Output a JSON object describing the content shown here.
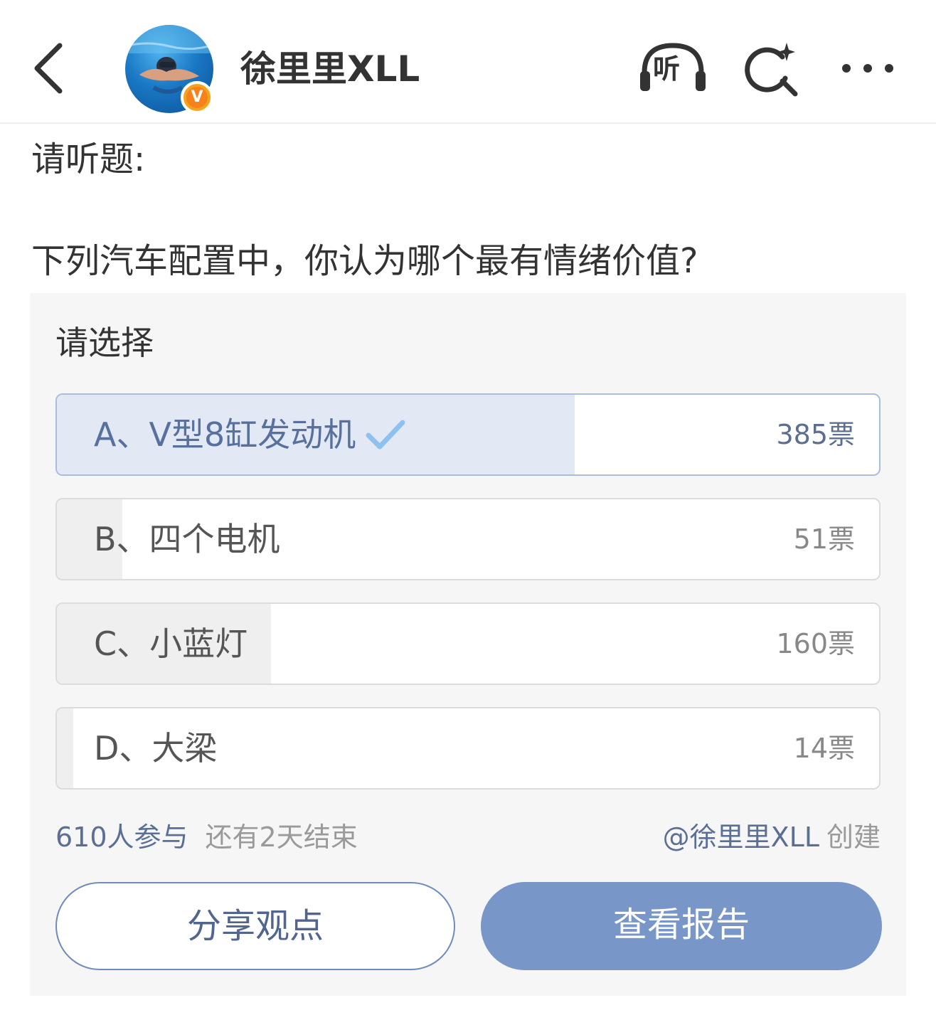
{
  "header": {
    "username": "徐里里XLL",
    "verified_badge": "V",
    "listen_label": "听",
    "icons": [
      "back-arrow-icon",
      "avatar",
      "listen-headphones-icon",
      "search-sparkle-icon",
      "more-icon"
    ]
  },
  "post": {
    "title": "请听题:",
    "question": "下列汽车配置中，你认为哪个最有情绪价值?"
  },
  "poll": {
    "prompt": "请选择",
    "options": [
      {
        "label": "A、V型8缸发动机",
        "votes": "385票",
        "selected": true,
        "share": 0.63
      },
      {
        "label": "B、四个电机",
        "votes": "51票",
        "selected": false,
        "share": 0.08
      },
      {
        "label": "C、小蓝灯",
        "votes": "160票",
        "selected": false,
        "share": 0.26
      },
      {
        "label": "D、大梁",
        "votes": "14票",
        "selected": false,
        "share": 0.02
      }
    ],
    "participants": "610人参与",
    "deadline": "还有2天结束",
    "creator": "@徐里里XLL",
    "creator_suffix": "创建",
    "share_button": "分享观点",
    "report_button": "查看报告"
  },
  "colors": {
    "accent": "#7896c8",
    "selected_fill": "#e2e9f5",
    "link": "#5b6f95",
    "check": "#8fc1ee"
  }
}
